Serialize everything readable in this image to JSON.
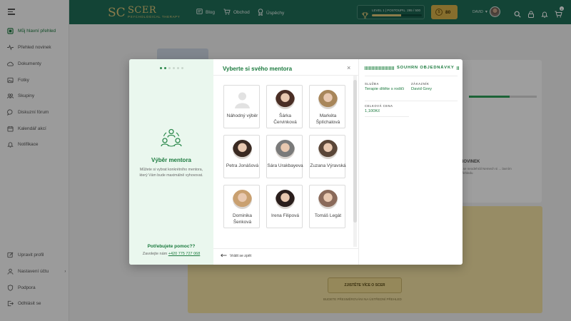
{
  "sidebar": {
    "items": [
      {
        "label": "Můj hlavní přehled",
        "icon": "dashboard-icon",
        "active": true
      },
      {
        "label": "Přehled novinek",
        "icon": "pulse-icon",
        "active": false
      },
      {
        "label": "Dokumenty",
        "icon": "cloud-icon",
        "active": false
      },
      {
        "label": "Fotky",
        "icon": "image-icon",
        "active": false
      },
      {
        "label": "Skupiny",
        "icon": "group-icon",
        "active": false
      },
      {
        "label": "Diskuzní fórum",
        "icon": "chat-icon",
        "active": false
      },
      {
        "label": "Kalendář akcí",
        "icon": "calendar-icon",
        "active": false
      },
      {
        "label": "Notifikace",
        "icon": "bell-icon",
        "active": false
      }
    ],
    "bottom_items": [
      {
        "label": "Upravit profil",
        "icon": "edit-icon"
      },
      {
        "label": "Nastavení účtu",
        "icon": "user-icon"
      },
      {
        "label": "Podpora",
        "icon": "shield-icon"
      },
      {
        "label": "Odhlásit se",
        "icon": "logout-icon"
      }
    ]
  },
  "header": {
    "logo_title": "SCER",
    "logo_subtitle": "PSYCHOLOGICAL THERAPY",
    "logo_mark": "SC",
    "nav": [
      {
        "label": "Blog",
        "icon": "blog-icon"
      },
      {
        "label": "Obchod",
        "icon": "cart-icon"
      },
      {
        "label": "Úspěchy",
        "icon": "award-icon"
      }
    ],
    "level_label": "LEVEL 1 | POSTOUPIL",
    "level_points": "295 / 500",
    "level_progress": 0.59,
    "coins": "80",
    "coin_symbol": "$",
    "user_name": "DAVID",
    "cart_count": "1"
  },
  "background": {
    "news_title": "NOVINEK",
    "news_text": "...se neodehrál Nemech si ... lavním přehledu",
    "button_label": "ZJISTĚTE VÍCE O SCER",
    "note": "BUDETE PŘESMĚROVÁNI NA ÚSTŘEDNÍ PŘEHLED"
  },
  "modal": {
    "left": {
      "steps_total": 6,
      "step_current": 2,
      "title": "Výběr mentora",
      "description": "Můžete si vybrat konkrétního mentora, který Vám bude maximálně vyhovovat.",
      "help_title": "Potřebujete pomoc??",
      "help_prefix": "Zavolejte nám",
      "help_phone": "+420 775 727 068"
    },
    "title": "Vyberte si svého mentora",
    "close_symbol": "×",
    "back_label": "Vrátit se zpět",
    "mentors": [
      {
        "name": "Náhodný výběr",
        "photo": "placeholder"
      },
      {
        "name": "Šárka Červinková",
        "photo": "#4a2e25"
      },
      {
        "name": "Markéta Šplíchalová",
        "photo": "#a8865a"
      },
      {
        "name": "Petra Jonášová",
        "photo": "#3a2a22"
      },
      {
        "name": "Sára Urakbayeva",
        "photo": "#7a7a7a"
      },
      {
        "name": "Zuzana Výravská",
        "photo": "#5a4638"
      },
      {
        "name": "Dominika Šenková",
        "photo": "#c9a070"
      },
      {
        "name": "Irena Filipová",
        "photo": "#2a1e1c"
      },
      {
        "name": "Tomáš Legát",
        "photo": "#8a6a5a"
      }
    ],
    "summary": {
      "title": "SOUHRN OBJEDNÁVKY",
      "service_label": "SLUŽBA",
      "service_value": "Terapie dítěte s rodiči",
      "customer_label": "ZÁKAZNÍK",
      "customer_value": "David Grey",
      "total_label": "CELKOVÁ CENA",
      "total_value": "1,100Kč"
    }
  },
  "colors": {
    "brand_green": "#1f6e58",
    "accent_green": "#1b7a3e",
    "gold": "#d8b24a"
  }
}
